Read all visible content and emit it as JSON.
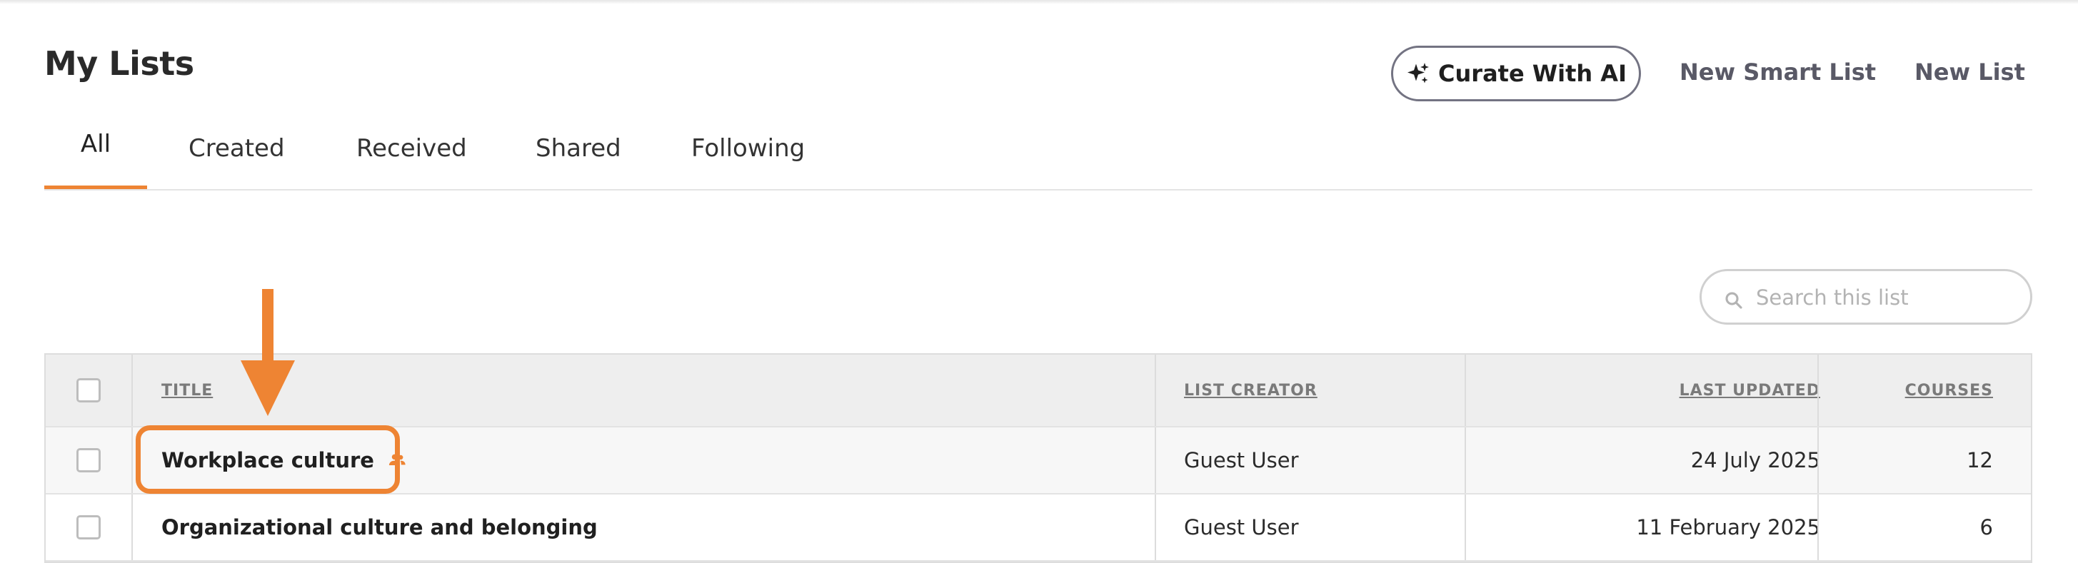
{
  "header": {
    "title": "My Lists",
    "curate_label": "Curate With AI",
    "new_smart_list_label": "New Smart List",
    "new_list_label": "New List"
  },
  "tabs": [
    {
      "label": "All",
      "active": true
    },
    {
      "label": "Created",
      "active": false
    },
    {
      "label": "Received",
      "active": false
    },
    {
      "label": "Shared",
      "active": false
    },
    {
      "label": "Following",
      "active": false
    }
  ],
  "search": {
    "placeholder": "Search this list",
    "value": ""
  },
  "table": {
    "columns": {
      "title": "TITLE",
      "creator": "LIST CREATOR",
      "updated": "LAST UPDATED",
      "courses": "COURSES"
    },
    "rows": [
      {
        "title": "Workplace culture",
        "shared": true,
        "creator": "Guest User",
        "updated": "24 July 2025",
        "courses": "12"
      },
      {
        "title": "Organizational culture and belonging",
        "shared": false,
        "creator": "Guest User",
        "updated": "11 February 2025",
        "courses": "6"
      }
    ]
  },
  "colors": {
    "accent": "#ee8433",
    "button_border": "#737382",
    "header_row_bg": "#eeeeee"
  },
  "icons": {
    "curate": "sparkle-icon",
    "search": "search-icon",
    "shared": "people-icon",
    "annotation": "arrow-down-icon"
  }
}
